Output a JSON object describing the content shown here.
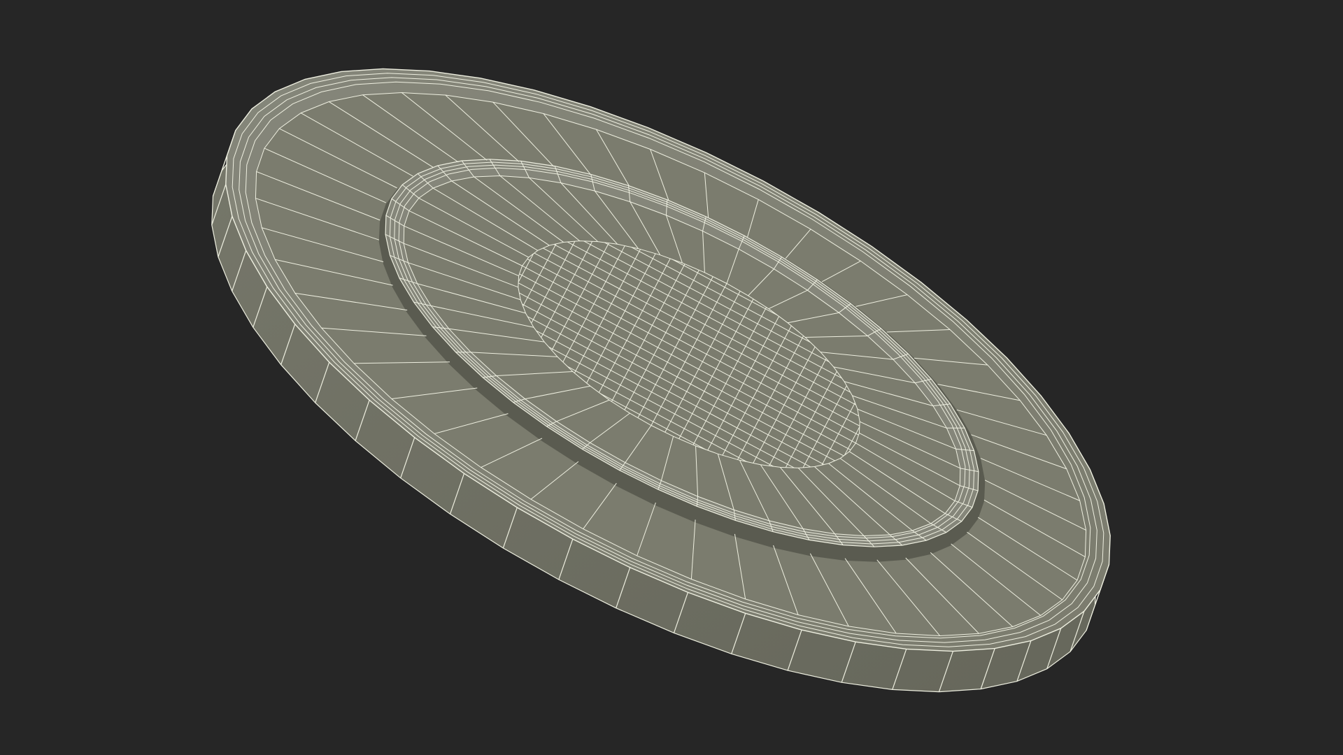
{
  "scene": {
    "subject": "coin-wireframe",
    "colors": {
      "background": "#262626",
      "surface": "#7b7c6e",
      "surface_light": "#85867a",
      "surface_dark": "#66675b",
      "rim_side": "#76776a",
      "shadow": "#5a5b50",
      "wire": "#eeefe0"
    }
  }
}
